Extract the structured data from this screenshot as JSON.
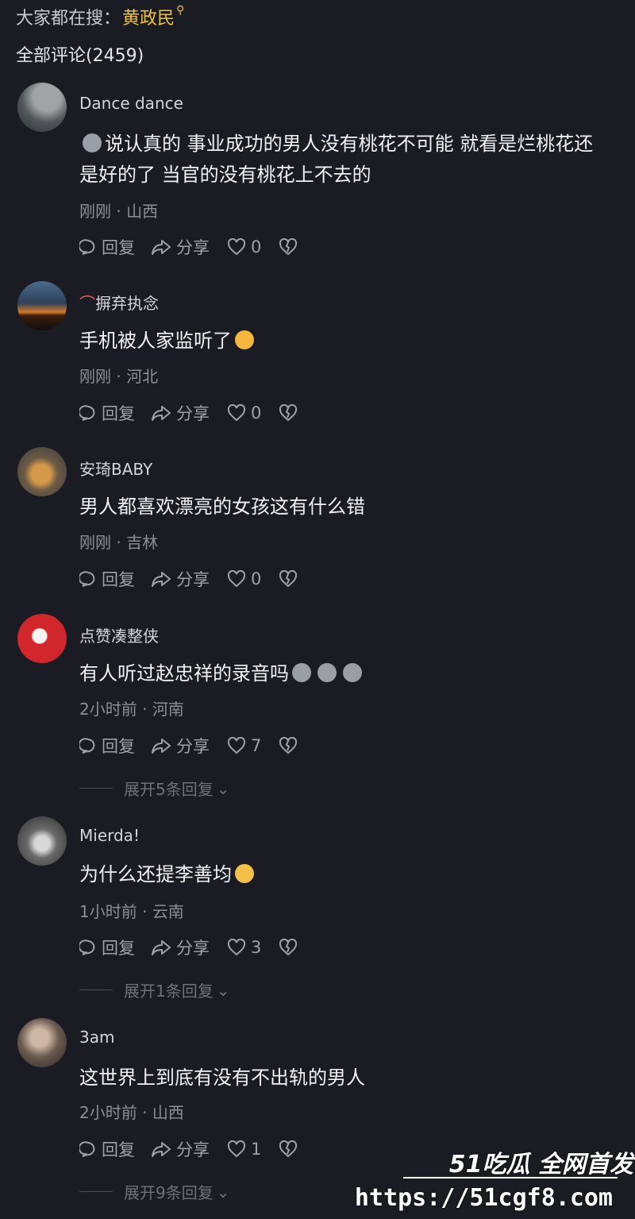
{
  "search": {
    "prefix": "大家都在搜：",
    "term": "黄政民"
  },
  "comments_header": "全部评论(2459)",
  "actions": {
    "reply": "回复",
    "share": "分享"
  },
  "comments": [
    {
      "username": "Dance dance",
      "text_line1": "说认真的 事业成功的男人没有桃花不可能 就看是烂桃花还",
      "text_line2": "是好的了 当官的没有桃花上不去的",
      "time": "刚刚",
      "region": "山西",
      "likes": "0"
    },
    {
      "username": "摒弃执念",
      "text": "手机被人家监听了",
      "time": "刚刚",
      "region": "河北",
      "likes": "0"
    },
    {
      "username": "安琦BABY",
      "text": "男人都喜欢漂亮的女孩这有什么错",
      "time": "刚刚",
      "region": "吉林",
      "likes": "0"
    },
    {
      "username": "点赞凑整侠",
      "text": "有人听过赵忠祥的录音吗",
      "time": "2小时前",
      "region": "河南",
      "likes": "7",
      "expand": "展开5条回复"
    },
    {
      "username": "Mierda!",
      "text": "为什么还提李善均",
      "time": "1小时前",
      "region": "云南",
      "likes": "3",
      "expand": "展开1条回复"
    },
    {
      "username": "3am",
      "text": "这世界上到底有没有不出轨的男人",
      "time": "2小时前",
      "region": "山西",
      "likes": "1",
      "expand": "展开9条回复"
    }
  ],
  "watermark": {
    "brand": "51吃瓜 全网首发",
    "url": "https://51cgf8.com"
  }
}
